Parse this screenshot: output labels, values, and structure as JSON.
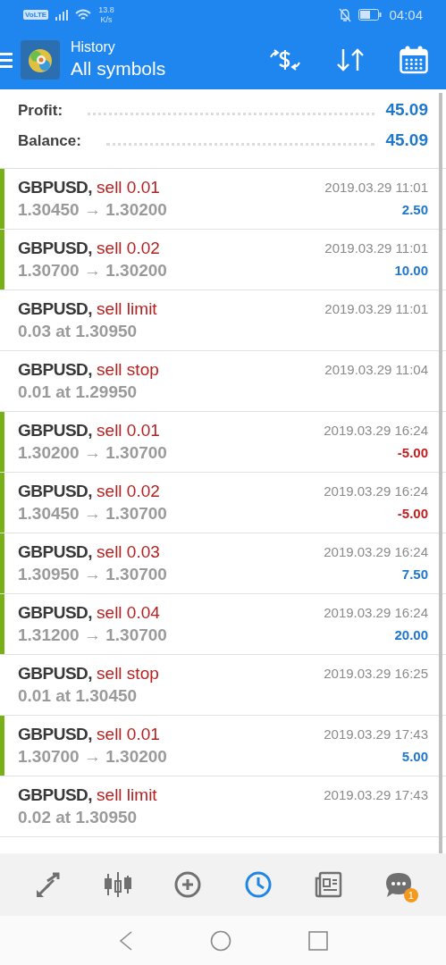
{
  "status_bar": {
    "network": "VoLTE",
    "speed": "13.8",
    "speed_unit": "K/s",
    "time": "04:04"
  },
  "header": {
    "title": "History",
    "subtitle": "All symbols"
  },
  "summary": [
    {
      "label": "Profit:",
      "value": "45.09"
    },
    {
      "label": "Balance:",
      "value": "45.09"
    }
  ],
  "rows": [
    {
      "kind": "deal",
      "symbol": "GBPUSD,",
      "action": "sell 0.01",
      "time": "2019.03.29 11:01",
      "detail": "1.30450 → 1.30200",
      "profit": "2.50",
      "negative": false
    },
    {
      "kind": "deal",
      "symbol": "GBPUSD,",
      "action": "sell 0.02",
      "time": "2019.03.29 11:01",
      "detail": "1.30700 → 1.30200",
      "profit": "10.00",
      "negative": false
    },
    {
      "kind": "order",
      "symbol": "GBPUSD,",
      "action": "sell limit",
      "time": "2019.03.29 11:01",
      "detail": "0.03 at 1.30950"
    },
    {
      "kind": "order",
      "symbol": "GBPUSD,",
      "action": "sell stop",
      "time": "2019.03.29 11:04",
      "detail": "0.01 at 1.29950"
    },
    {
      "kind": "deal",
      "symbol": "GBPUSD,",
      "action": "sell 0.01",
      "time": "2019.03.29 16:24",
      "detail": "1.30200 → 1.30700",
      "profit": "-5.00",
      "negative": true
    },
    {
      "kind": "deal",
      "symbol": "GBPUSD,",
      "action": "sell 0.02",
      "time": "2019.03.29 16:24",
      "detail": "1.30450 → 1.30700",
      "profit": "-5.00",
      "negative": true
    },
    {
      "kind": "deal",
      "symbol": "GBPUSD,",
      "action": "sell 0.03",
      "time": "2019.03.29 16:24",
      "detail": "1.30950 → 1.30700",
      "profit": "7.50",
      "negative": false
    },
    {
      "kind": "deal",
      "symbol": "GBPUSD,",
      "action": "sell 0.04",
      "time": "2019.03.29 16:24",
      "detail": "1.31200 → 1.30700",
      "profit": "20.00",
      "negative": false
    },
    {
      "kind": "order",
      "symbol": "GBPUSD,",
      "action": "sell stop",
      "time": "2019.03.29 16:25",
      "detail": "0.01 at 1.30450"
    },
    {
      "kind": "deal",
      "symbol": "GBPUSD,",
      "action": "sell 0.01",
      "time": "2019.03.29 17:43",
      "detail": "1.30700 → 1.30200",
      "profit": "5.00",
      "negative": false
    },
    {
      "kind": "order",
      "symbol": "GBPUSD,",
      "action": "sell limit",
      "time": "2019.03.29 17:43",
      "detail": "0.02 at 1.30950"
    }
  ],
  "bottom_nav": [
    {
      "kind": "quotes",
      "selected": false
    },
    {
      "kind": "chart",
      "selected": false
    },
    {
      "kind": "trade",
      "selected": false
    },
    {
      "kind": "history",
      "selected": true
    },
    {
      "kind": "news",
      "selected": false
    },
    {
      "kind": "chat",
      "selected": false,
      "badge": "1"
    }
  ]
}
